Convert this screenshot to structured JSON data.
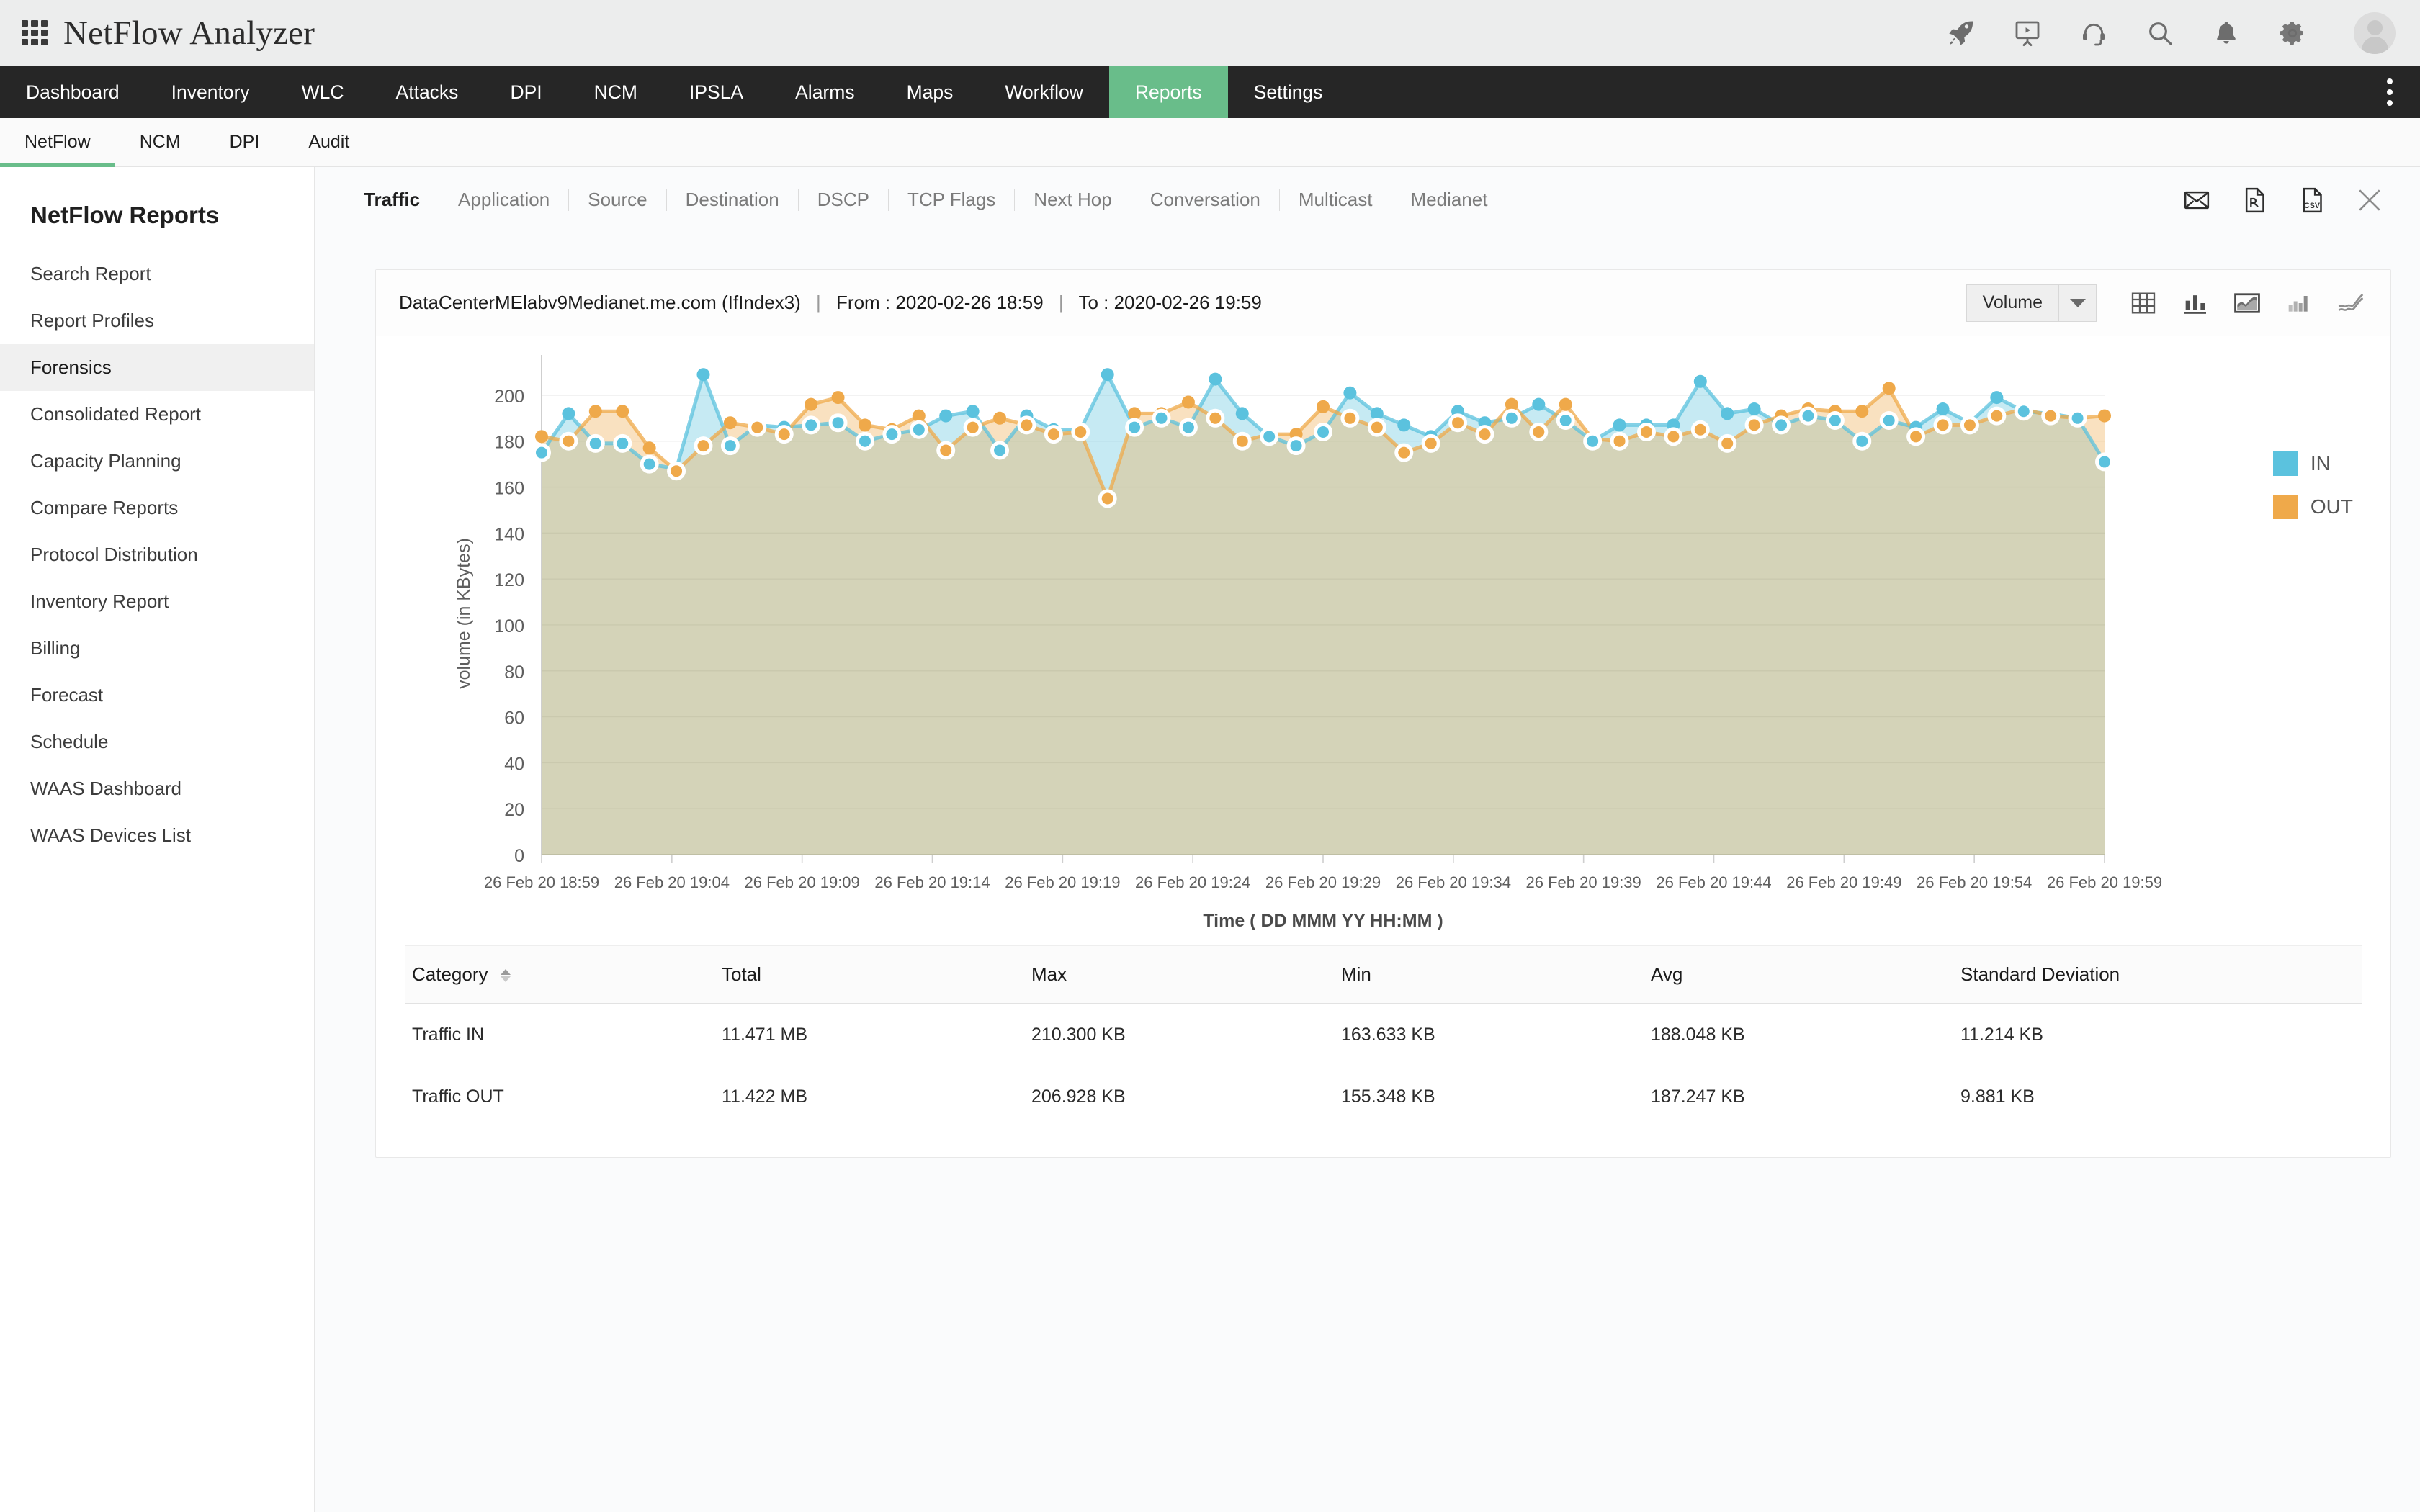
{
  "app": {
    "title": "NetFlow Analyzer",
    "grid_icon": "apps-grid-icon",
    "top_icons": [
      "rocket-icon",
      "presentation-icon",
      "headset-icon",
      "search-icon",
      "bell-icon",
      "gear-icon",
      "avatar"
    ]
  },
  "mainnav": {
    "items": [
      {
        "label": "Dashboard",
        "active": false
      },
      {
        "label": "Inventory",
        "active": false
      },
      {
        "label": "WLC",
        "active": false
      },
      {
        "label": "Attacks",
        "active": false
      },
      {
        "label": "DPI",
        "active": false
      },
      {
        "label": "NCM",
        "active": false
      },
      {
        "label": "IPSLA",
        "active": false
      },
      {
        "label": "Alarms",
        "active": false
      },
      {
        "label": "Maps",
        "active": false
      },
      {
        "label": "Workflow",
        "active": false
      },
      {
        "label": "Reports",
        "active": true
      },
      {
        "label": "Settings",
        "active": false
      }
    ],
    "active_color": "#69bd8a",
    "kebab": "more-vertical-icon"
  },
  "subnav": {
    "items": [
      {
        "label": "NetFlow",
        "active": true
      },
      {
        "label": "NCM",
        "active": false
      },
      {
        "label": "DPI",
        "active": false
      },
      {
        "label": "Audit",
        "active": false
      }
    ]
  },
  "sidebar": {
    "heading": "NetFlow Reports",
    "items": [
      {
        "label": "Search Report",
        "active": false
      },
      {
        "label": "Report Profiles",
        "active": false
      },
      {
        "label": "Forensics",
        "active": true
      },
      {
        "label": "Consolidated Report",
        "active": false
      },
      {
        "label": "Capacity Planning",
        "active": false
      },
      {
        "label": "Compare Reports",
        "active": false
      },
      {
        "label": "Protocol Distribution",
        "active": false
      },
      {
        "label": "Inventory Report",
        "active": false
      },
      {
        "label": "Billing",
        "active": false
      },
      {
        "label": "Forecast",
        "active": false
      },
      {
        "label": "Schedule",
        "active": false
      },
      {
        "label": "WAAS Dashboard",
        "active": false
      },
      {
        "label": "WAAS Devices List",
        "active": false
      }
    ]
  },
  "content_tabs": {
    "items": [
      {
        "label": "Traffic",
        "active": true
      },
      {
        "label": "Application",
        "active": false
      },
      {
        "label": "Source",
        "active": false
      },
      {
        "label": "Destination",
        "active": false
      },
      {
        "label": "DSCP",
        "active": false
      },
      {
        "label": "TCP Flags",
        "active": false
      },
      {
        "label": "Next Hop",
        "active": false
      },
      {
        "label": "Conversation",
        "active": false
      },
      {
        "label": "Multicast",
        "active": false
      },
      {
        "label": "Medianet",
        "active": false
      }
    ],
    "actions": [
      "email-icon",
      "pdf-export-icon",
      "csv-export-icon",
      "close-icon"
    ]
  },
  "report": {
    "device": "DataCenterMElabv9Medianet.me.com (IfIndex3)",
    "separator": "|",
    "from_label": "From : 2020-02-26 18:59",
    "to_label": "To : 2020-02-26 19:59",
    "metric_select": {
      "value": "Volume",
      "caret": "chevron-down-icon"
    },
    "chart_type_icons": [
      "table-view-icon",
      "bar-chart-icon",
      "area-chart-icon",
      "column-chart-icon",
      "line-chart-icon"
    ]
  },
  "chart_data": {
    "type": "area",
    "title": "",
    "xlabel": "Time ( DD MMM YY HH:MM )",
    "ylabel": "volume (in KBytes)",
    "ylim": [
      0,
      210
    ],
    "yticks": [
      0,
      20,
      40,
      60,
      80,
      100,
      120,
      140,
      160,
      180,
      200
    ],
    "grid": true,
    "legend_position": "right",
    "colors": {
      "IN": "#5bc2de",
      "OUT": "#efa94a",
      "overlap_fill": "#d3d2b6"
    },
    "xtick_labels": [
      "26 Feb 20 18:59",
      "26 Feb 20 19:04",
      "26 Feb 20 19:09",
      "26 Feb 20 19:14",
      "26 Feb 20 19:19",
      "26 Feb 20 19:24",
      "26 Feb 20 19:29",
      "26 Feb 20 19:34",
      "26 Feb 20 19:39",
      "26 Feb 20 19:44",
      "26 Feb 20 19:49",
      "26 Feb 20 19:54",
      "26 Feb 20 19:59"
    ],
    "series": [
      {
        "name": "IN",
        "color": "#5bc2de",
        "values": [
          175,
          192,
          179,
          179,
          170,
          168,
          209,
          178,
          187,
          186,
          187,
          188,
          180,
          183,
          185,
          191,
          193,
          176,
          191,
          185,
          185,
          209,
          186,
          190,
          186,
          207,
          192,
          182,
          178,
          184,
          201,
          192,
          187,
          182,
          193,
          188,
          190,
          196,
          189,
          180,
          187,
          187,
          187,
          206,
          192,
          194,
          187,
          191,
          189,
          180,
          189,
          186,
          194,
          188,
          199,
          193,
          192,
          190,
          171
        ]
      },
      {
        "name": "OUT",
        "color": "#efa94a",
        "values": [
          182,
          180,
          193,
          193,
          177,
          167,
          178,
          188,
          186,
          183,
          196,
          199,
          187,
          185,
          191,
          176,
          186,
          190,
          187,
          183,
          184,
          155,
          192,
          192,
          197,
          190,
          180,
          183,
          183,
          195,
          190,
          186,
          175,
          179,
          188,
          183,
          196,
          184,
          196,
          181,
          180,
          184,
          182,
          185,
          179,
          187,
          191,
          194,
          193,
          193,
          203,
          182,
          187,
          187,
          191,
          194,
          191,
          190,
          191
        ]
      }
    ]
  },
  "summary_table": {
    "columns": [
      "Category",
      "Total",
      "Max",
      "Min",
      "Avg",
      "Standard Deviation"
    ],
    "sort_column": "Category",
    "rows": [
      {
        "Category": "Traffic IN",
        "Total": "11.471 MB",
        "Max": "210.300 KB",
        "Min": "163.633 KB",
        "Avg": "188.048 KB",
        "Standard Deviation": "11.214 KB"
      },
      {
        "Category": "Traffic OUT",
        "Total": "11.422 MB",
        "Max": "206.928 KB",
        "Min": "155.348 KB",
        "Avg": "187.247 KB",
        "Standard Deviation": "9.881 KB"
      }
    ]
  }
}
